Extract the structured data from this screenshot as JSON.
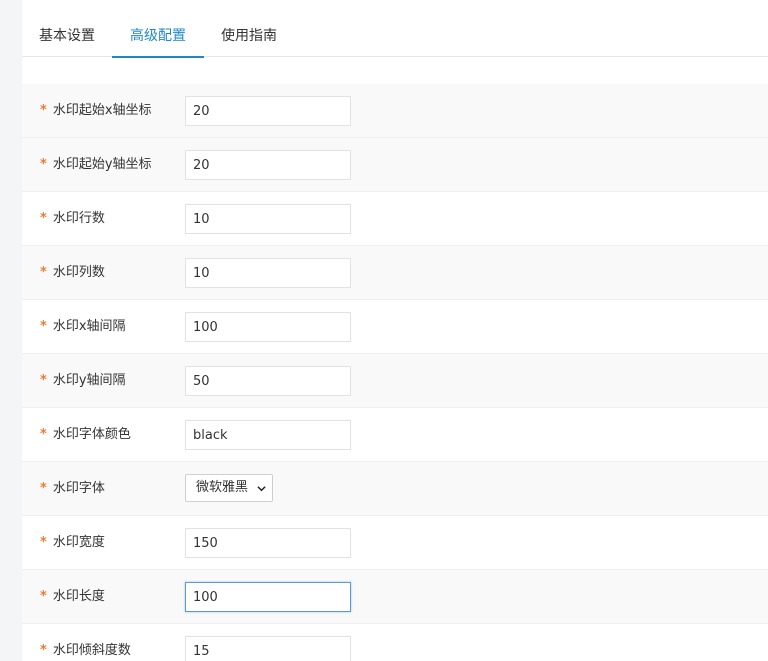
{
  "tabs": [
    {
      "label": "基本设置",
      "active": false
    },
    {
      "label": "高级配置",
      "active": true
    },
    {
      "label": "使用指南",
      "active": false
    }
  ],
  "required_marker": "*",
  "fields": [
    {
      "label": "水印起始x轴坐标",
      "value": "20"
    },
    {
      "label": "水印起始y轴坐标",
      "value": "20"
    },
    {
      "label": "水印行数",
      "value": "10"
    },
    {
      "label": "水印列数",
      "value": "10"
    },
    {
      "label": "水印x轴间隔",
      "value": "100"
    },
    {
      "label": "水印y轴间隔",
      "value": "50"
    },
    {
      "label": "水印字体颜色",
      "value": "black"
    },
    {
      "label": "水印字体",
      "value": "微软雅黑"
    },
    {
      "label": "水印宽度",
      "value": "150"
    },
    {
      "label": "水印长度",
      "value": "100"
    },
    {
      "label": "水印倾斜度数",
      "value": "15"
    }
  ],
  "colors": {
    "accent": "#1e88c7",
    "required": "#f07a2f",
    "focus_border": "#5b9bd5"
  }
}
